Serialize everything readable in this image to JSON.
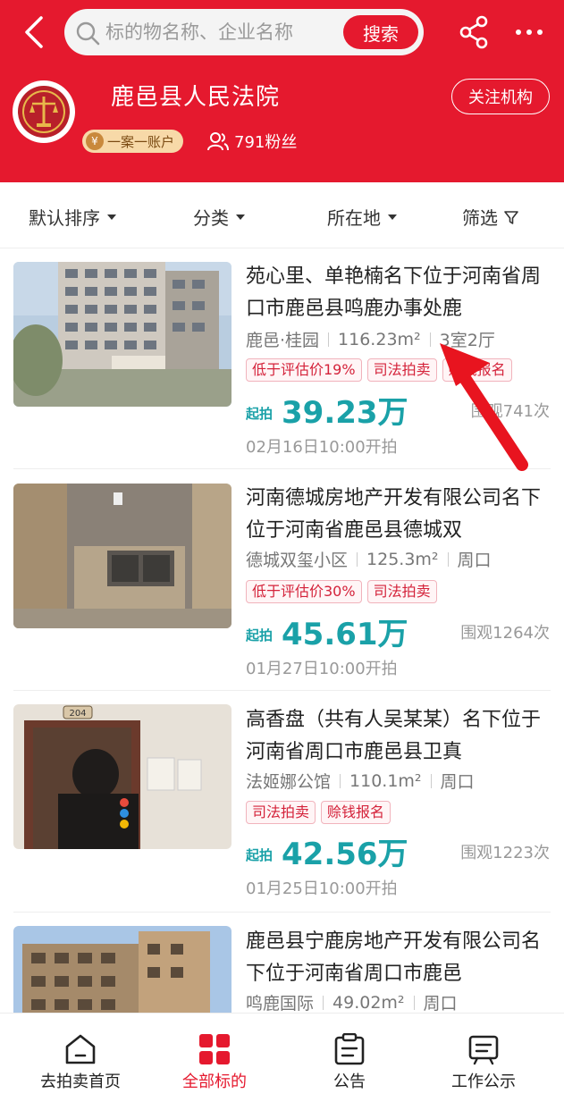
{
  "header": {
    "search_placeholder": "标的物名称、企业名称",
    "search_button": "搜索",
    "court_name": "鹿邑县人民法院",
    "follow_label": "关注机构",
    "badge_label": "一案一账户",
    "fans_label": "791粉丝"
  },
  "filters": [
    "默认排序",
    "分类",
    "所在地",
    "筛选"
  ],
  "listings": [
    {
      "title": "苑心里、单艳楠名下位于河南省周口市鹿邑县鸣鹿办事处鹿",
      "meta": [
        "鹿邑·桂园",
        "116.23m²",
        "3室2厅"
      ],
      "tags": [
        "低于评估价19%",
        "司法拍卖",
        "赊钱报名"
      ],
      "start_label": "起拍",
      "price": "39.23万",
      "views": "围观741次",
      "date": "02月16日10:00开拍"
    },
    {
      "title": "河南德城房地产开发有限公司名下位于河南省鹿邑县德城双",
      "meta": [
        "德城双玺小区",
        "125.3m²",
        "周口"
      ],
      "tags": [
        "低于评估价30%",
        "司法拍卖"
      ],
      "start_label": "起拍",
      "price": "45.61万",
      "views": "围观1264次",
      "date": "01月27日10:00开拍"
    },
    {
      "title": "高香盘（共有人吴某某）名下位于河南省周口市鹿邑县卫真",
      "meta": [
        "法姬娜公馆",
        "110.1m²",
        "周口"
      ],
      "tags": [
        "司法拍卖",
        "赊钱报名"
      ],
      "start_label": "起拍",
      "price": "42.56万",
      "views": "围观1223次",
      "date": "01月25日10:00开拍"
    },
    {
      "title": "鹿邑县宁鹿房地产开发有限公司名下位于河南省周口市鹿邑",
      "meta": [
        "鸣鹿国际",
        "49.02m²",
        "周口"
      ],
      "tags": [],
      "start_label": "",
      "price": "",
      "views": "",
      "date": ""
    }
  ],
  "door_number": "204",
  "tabs": [
    "去拍卖首页",
    "全部标的",
    "公告",
    "工作公示"
  ],
  "colors": {
    "brand_red": "#e5192e",
    "price_teal": "#1aa1a8"
  }
}
